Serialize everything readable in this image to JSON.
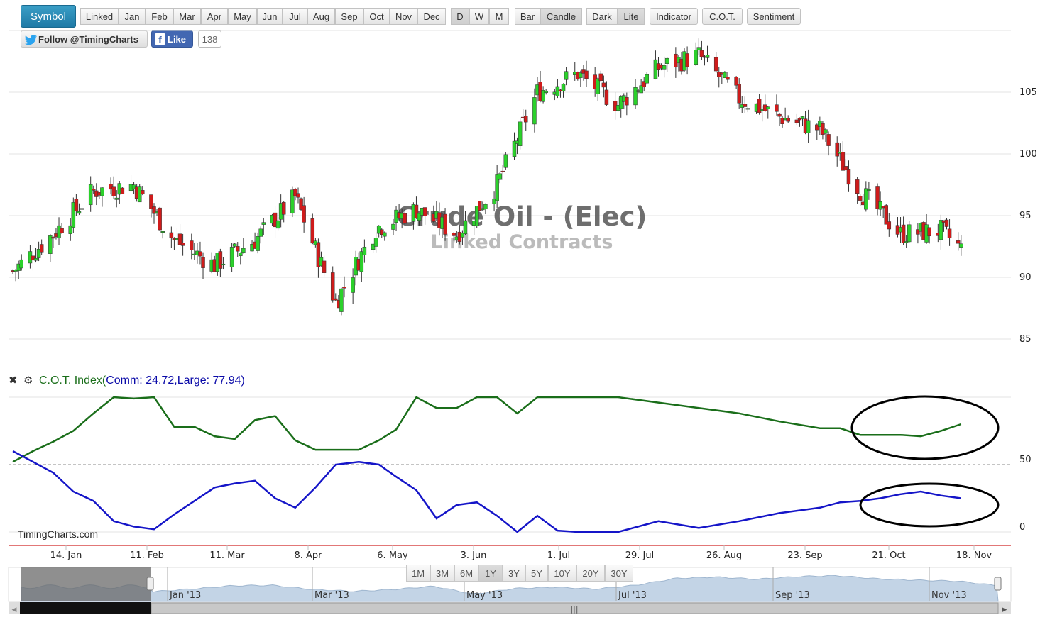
{
  "toolbar": {
    "symbol": "Symbol",
    "period_buttons": [
      "Linked",
      "Jan",
      "Feb",
      "Mar",
      "Apr",
      "May",
      "Jun",
      "Jul",
      "Aug",
      "Sep",
      "Oct",
      "Nov",
      "Dec"
    ],
    "interval_buttons": [
      "D",
      "W",
      "M"
    ],
    "style_buttons": [
      "Bar",
      "Candle"
    ],
    "theme_buttons": [
      "Dark",
      "Lite"
    ],
    "indicator": "Indicator",
    "cot": "C.O.T.",
    "sentiment": "Sentiment",
    "active": [
      "Candle",
      "Lite"
    ]
  },
  "social": {
    "twitter": "Follow @TimingCharts",
    "facebook": "Like",
    "like_count": "138"
  },
  "colors": {
    "up": "#2bd12b",
    "down": "#cf1b1b",
    "commercial": "#1a6e1a",
    "large": "#1515c8",
    "accent": "#2389b6"
  },
  "watermark": {
    "title": "Crude Oil - (Elec)",
    "subtitle": "Linked Contracts"
  },
  "cot_legend": {
    "name": "C.O.T. Index(",
    "comm": "Comm: 24.72",
    "sep": ",",
    "large": "Large: 77.94",
    "close": ")"
  },
  "brand": "TimingCharts.com",
  "navigator": {
    "buttons": [
      "1M",
      "3M",
      "6M",
      "1Y",
      "3Y",
      "5Y",
      "10Y",
      "20Y",
      "30Y"
    ],
    "active": "1Y",
    "labels": [
      "Jan '13",
      "Mar '13",
      "May '13",
      "Jul '13",
      "Sep '13",
      "Nov '13"
    ]
  },
  "chart_data": [
    {
      "type": "candlestick",
      "title": "Crude Oil - (Elec)",
      "subtitle": "Linked Contracts",
      "x_tick_labels": [
        "14. Jan",
        "11. Feb",
        "11. Mar",
        "8. Apr",
        "6. May",
        "3. Jun",
        "1. Jul",
        "29. Jul",
        "26. Aug",
        "23. Sep",
        "21. Oct",
        "18. Nov"
      ],
      "y_ticks": [
        85,
        90,
        95,
        100,
        105
      ],
      "ylim": [
        84,
        112
      ],
      "grid": true,
      "series": [
        {
          "x": [
            "Jan 1",
            "Jan 15",
            "Jan 29",
            "Feb 12",
            "Feb 26",
            "Mar 12",
            "Mar 26",
            "Apr 9",
            "Apr 23",
            "May 7",
            "May 21",
            "Jun 4",
            "Jun 18",
            "Jul 2",
            "Jul 16",
            "Jul 30",
            "Aug 13",
            "Aug 27",
            "Sep 10",
            "Sep 24",
            "Oct 8",
            "Oct 22",
            "Nov 5",
            "Nov 19",
            "Nov 26"
          ],
          "close": [
            90.5,
            93.5,
            97.0,
            97.5,
            93.0,
            91.0,
            93.0,
            96.5,
            88.0,
            94.0,
            95.5,
            93.5,
            97.5,
            105.0,
            106.5,
            104.0,
            107.0,
            108.0,
            104.5,
            103.0,
            102.0,
            97.0,
            93.5,
            93.8,
            92.3
          ]
        }
      ]
    },
    {
      "type": "line",
      "title": "C.O.T. Index",
      "y_ticks": [
        0,
        50
      ],
      "ylim": [
        0,
        100
      ],
      "reference_line": 50,
      "series": [
        {
          "name": "Comm",
          "x": [
            "Jan 1",
            "Jan 8",
            "Jan 15",
            "Jan 22",
            "Jan 29",
            "Feb 5",
            "Feb 12",
            "Feb 19",
            "Feb 26",
            "Mar 5",
            "Mar 12",
            "Mar 19",
            "Mar 26",
            "Apr 2",
            "Apr 9",
            "Apr 16",
            "Apr 23",
            "May 1",
            "May 8",
            "May 14",
            "May 21",
            "May 28",
            "Jun 4",
            "Jun 11",
            "Jun 18",
            "Jun 25",
            "Jul 2",
            "Jul 9",
            "Jul 16",
            "Jul 30",
            "Aug 13",
            "Aug 27",
            "Sep 10",
            "Sep 24",
            "Oct 8",
            "Oct 15",
            "Oct 22",
            "Oct 29",
            "Nov 5",
            "Nov 12",
            "Nov 19",
            "Nov 26"
          ],
          "values": [
            52,
            60,
            67,
            75,
            88,
            100,
            99,
            100,
            78,
            78,
            71,
            69,
            83,
            86,
            68,
            61,
            61,
            61,
            68,
            76,
            100,
            92,
            92,
            100,
            100,
            88,
            100,
            100,
            100,
            100,
            96,
            92,
            88,
            82,
            77,
            77,
            72,
            72,
            72,
            71,
            75,
            80
          ]
        },
        {
          "name": "Large",
          "x": [
            "Jan 1",
            "Jan 8",
            "Jan 15",
            "Jan 22",
            "Jan 29",
            "Feb 5",
            "Feb 12",
            "Feb 19",
            "Feb 26",
            "Mar 5",
            "Mar 12",
            "Mar 19",
            "Mar 26",
            "Apr 2",
            "Apr 9",
            "Apr 16",
            "Apr 23",
            "May 1",
            "May 8",
            "May 14",
            "May 21",
            "May 28",
            "Jun 4",
            "Jun 11",
            "Jun 18",
            "Jun 25",
            "Jul 2",
            "Jul 9",
            "Jul 16",
            "Jul 30",
            "Aug 13",
            "Aug 27",
            "Sep 10",
            "Sep 24",
            "Oct 8",
            "Oct 15",
            "Oct 22",
            "Oct 29",
            "Nov 5",
            "Nov 12",
            "Nov 19",
            "Nov 26"
          ],
          "values": [
            60,
            52,
            44,
            30,
            23,
            8,
            4,
            2,
            13,
            23,
            33,
            36,
            38,
            25,
            18,
            33,
            50,
            52,
            50,
            41,
            31,
            10,
            20,
            22,
            12,
            0,
            12,
            1,
            0,
            0,
            8,
            3,
            8,
            14,
            18,
            22,
            23,
            25,
            28,
            30,
            27,
            25
          ]
        }
      ]
    }
  ]
}
